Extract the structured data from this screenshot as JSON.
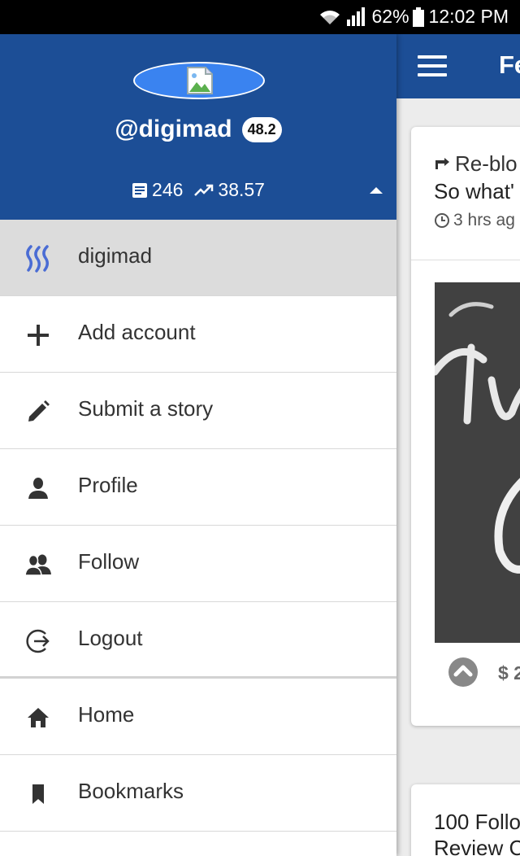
{
  "status_bar": {
    "battery_percent": "62%",
    "time": "12:02 PM",
    "icons": [
      "wifi-icon",
      "signal-icon",
      "battery-icon"
    ]
  },
  "feed_header": {
    "title": "Fe"
  },
  "post1": {
    "reblog_label": "Re-blo",
    "title": "So what'",
    "time": "3 hrs ag",
    "payout": "$ 2"
  },
  "post2": {
    "title_line1": "100 Follo",
    "title_line2": "Review C"
  },
  "profile": {
    "username": "@digimad",
    "reputation": "48.2",
    "posts_count": "246",
    "voting_power": "38.57"
  },
  "menu": {
    "items": [
      {
        "label": "digimad",
        "icon": "steem-logo-icon",
        "active": true
      },
      {
        "label": "Add account",
        "icon": "plus-icon"
      },
      {
        "label": "Submit a story",
        "icon": "pencil-icon"
      },
      {
        "label": "Profile",
        "icon": "person-icon"
      },
      {
        "label": "Follow",
        "icon": "people-icon"
      },
      {
        "label": "Logout",
        "icon": "logout-icon"
      },
      {
        "label": "Home",
        "icon": "home-icon"
      },
      {
        "label": "Bookmarks",
        "icon": "bookmark-icon"
      }
    ]
  },
  "colors": {
    "header_blue": "#1c4e96",
    "avatar_blue": "#3a83f0",
    "active_item_bg": "#dcdcdc"
  }
}
